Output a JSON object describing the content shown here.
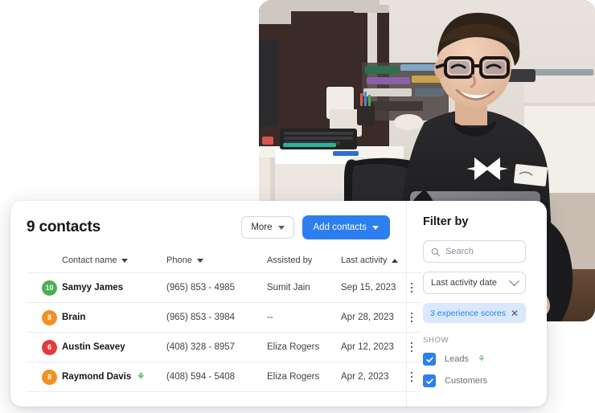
{
  "photo": {
    "alt": "Smiling man with glasses working on a laptop in an office"
  },
  "card": {
    "header": {
      "title": "9 contacts",
      "more_label": "More",
      "add_label": "Add contacts"
    },
    "table": {
      "columns": [
        {
          "label": "",
          "sort": "none"
        },
        {
          "label": "Contact name",
          "sort": "desc"
        },
        {
          "label": "Phone",
          "sort": "desc"
        },
        {
          "label": "Assisted by",
          "sort": "none"
        },
        {
          "label": "Last activity",
          "sort": "asc"
        },
        {
          "label": "",
          "sort": "none"
        }
      ],
      "rows": [
        {
          "score": "10",
          "score_color": "#4caf50",
          "name": "Samyy James",
          "flame": false,
          "phone": "(965) 853 - 4985",
          "assisted_by": "Sumit Jain",
          "last_activity": "Sep 15, 2023"
        },
        {
          "score": "8",
          "score_color": "#f29022",
          "name": "Brain",
          "flame": false,
          "phone": "(965) 853 - 3984",
          "assisted_by": "--",
          "last_activity": "Apr 28, 2023"
        },
        {
          "score": "6",
          "score_color": "#e13c3c",
          "name": "Austin Seavey",
          "flame": false,
          "phone": "(408) 328 - 8957",
          "assisted_by": "Eliza Rogers",
          "last_activity": "Apr 12, 2023"
        },
        {
          "score": "8",
          "score_color": "#f29022",
          "name": "Raymond Davis",
          "flame": true,
          "phone": "(408) 594 - 5408",
          "assisted_by": "Eliza Rogers",
          "last_activity": "Apr 2, 2023"
        }
      ]
    },
    "filter": {
      "title": "Filter by",
      "search_placeholder": "Search",
      "search_value": "",
      "date_select_value": "Last activity date",
      "chip_label": "3 experience scores",
      "show_label": "SHOW",
      "checkboxes": [
        {
          "label": "Leads",
          "checked": true,
          "flame": true
        },
        {
          "label": "Customers",
          "checked": true,
          "flame": false
        }
      ]
    }
  },
  "colors": {
    "accent": "#2d7ff0",
    "chip_bg": "#d9e8fd",
    "flame_green": "#5db85c"
  }
}
